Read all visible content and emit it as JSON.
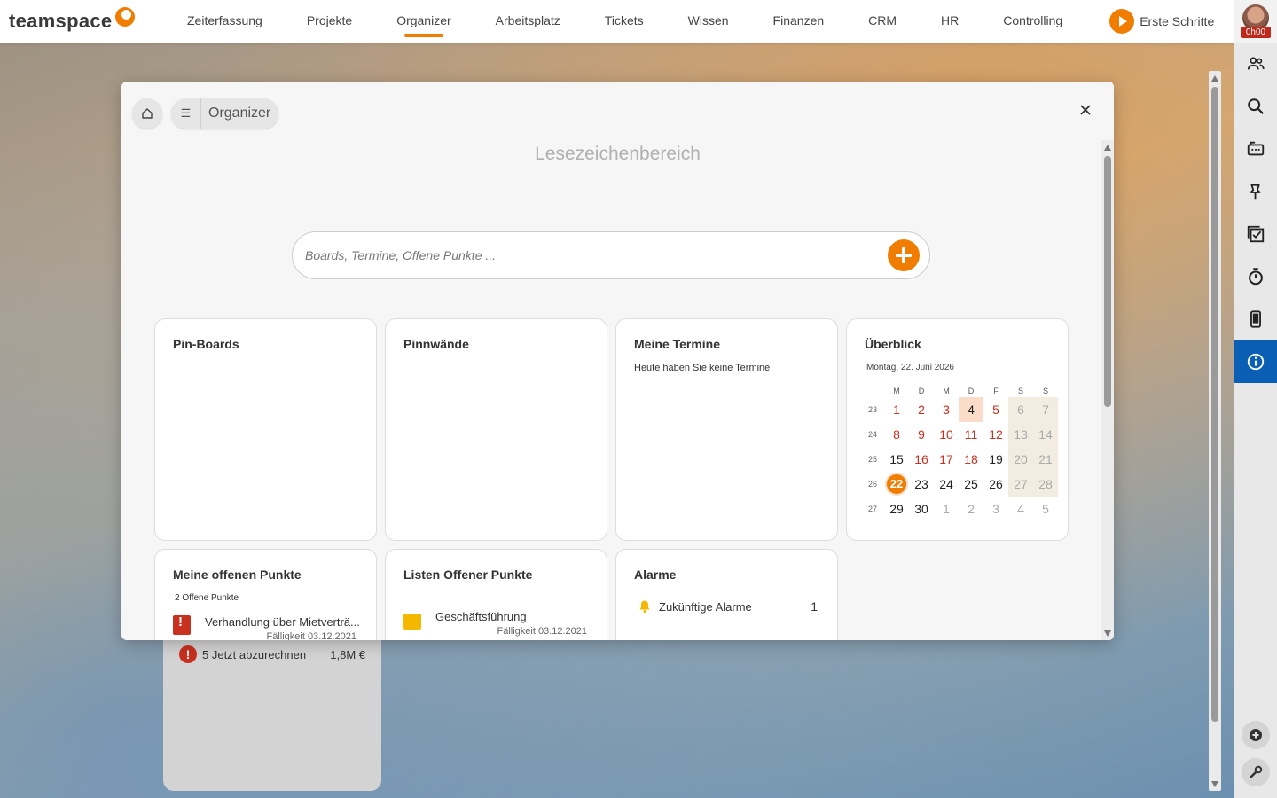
{
  "app": {
    "logo_text": "teamspace",
    "nav": [
      "Zeiterfassung",
      "Projekte",
      "Organizer",
      "Arbeitsplatz",
      "Tickets",
      "Wissen",
      "Finanzen",
      "CRM",
      "HR",
      "Controlling"
    ],
    "active_nav": "Organizer",
    "first_steps_label": "Erste Schritte",
    "timer_badge": "0h00"
  },
  "colors": {
    "accent": "#f07d00",
    "danger": "#c8301f",
    "sidebar_active": "#0a5fb4"
  },
  "sidebar_icons": [
    "users-icon",
    "search-icon",
    "inbox-icon",
    "pin-icon",
    "tasks-icon",
    "stopwatch-icon",
    "mobile-icon",
    "info-icon"
  ],
  "background_widget": {
    "label": "5 Jetzt abzurechnen",
    "amount": "1,8M €"
  },
  "modal": {
    "breadcrumb_label": "Organizer",
    "title": "Lesezeichenbereich",
    "search_placeholder": "Boards, Termine, Offene Punkte ..."
  },
  "cards": {
    "pinboards": {
      "title": "Pin-Boards"
    },
    "pinnwaende": {
      "title": "Pinnwände"
    },
    "termine": {
      "title": "Meine Termine",
      "text": "Heute haben Sie keine Termine"
    },
    "ueberblick": {
      "title": "Überblick",
      "date": "Montag, 22. Juni 2026",
      "weekdays": [
        "M",
        "D",
        "M",
        "D",
        "F",
        "S",
        "S"
      ],
      "weeks": [
        {
          "wk": "23",
          "days": [
            "1",
            "2",
            "3",
            "4",
            "5",
            "6",
            "7"
          ]
        },
        {
          "wk": "24",
          "days": [
            "8",
            "9",
            "10",
            "11",
            "12",
            "13",
            "14"
          ]
        },
        {
          "wk": "25",
          "days": [
            "15",
            "16",
            "17",
            "18",
            "19",
            "20",
            "21"
          ]
        },
        {
          "wk": "26",
          "days": [
            "22",
            "23",
            "24",
            "25",
            "26",
            "27",
            "28"
          ]
        },
        {
          "wk": "27",
          "days": [
            "29",
            "30",
            "1",
            "2",
            "3",
            "4",
            "5"
          ]
        }
      ]
    },
    "offene_punkte": {
      "title": "Meine offenen Punkte",
      "count_text": "2 Offene Punkte",
      "item_text": "Verhandlung über Mietverträ...",
      "item_due": "Fälligkeit 03.12.2021"
    },
    "listen": {
      "title": "Listen Offener Punkte",
      "item_text": "Geschäftsführung",
      "item_due": "Fälligkeit 03.12.2021"
    },
    "alarme": {
      "title": "Alarme",
      "row_label": "Zukünftige Alarme",
      "row_count": "1"
    }
  }
}
